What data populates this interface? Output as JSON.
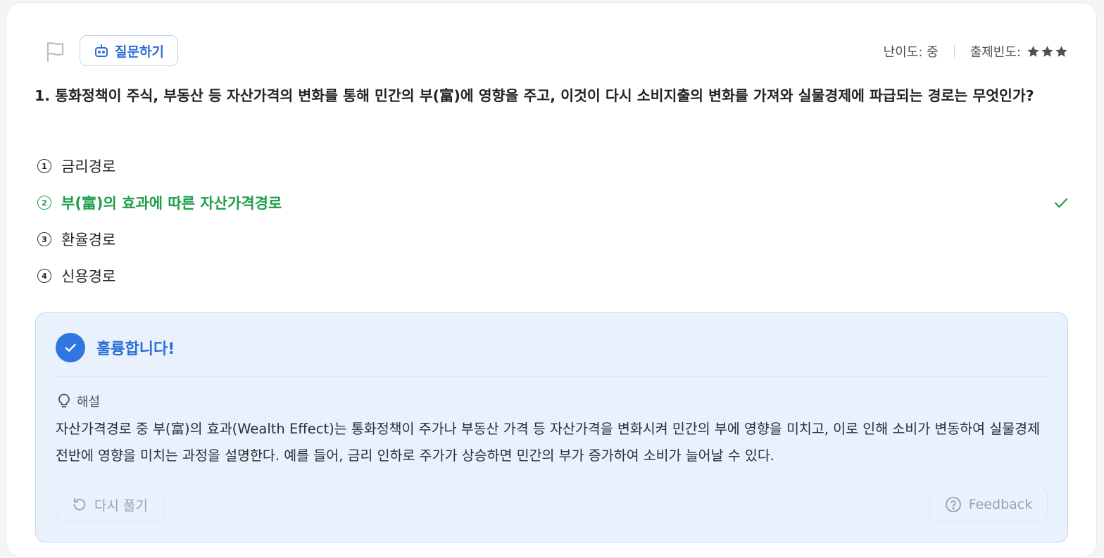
{
  "header": {
    "ask_label": "질문하기",
    "difficulty_label": "난이도: 중",
    "frequency_label": "출제빈도:",
    "frequency_stars": 3
  },
  "question": {
    "text": "1. 통화정책이 주식, 부동산 등 자산가격의 변화를 통해 민간의 부(富)에 영향을 주고, 이것이 다시 소비지출의 변화를 가져와 실물경제에 파급되는 경로는 무엇인가?"
  },
  "options": [
    {
      "num": "1",
      "label": "금리경로",
      "correct": false
    },
    {
      "num": "2",
      "label": "부(富)의 효과에 따른 자산가격경로",
      "correct": true
    },
    {
      "num": "3",
      "label": "환율경로",
      "correct": false
    },
    {
      "num": "4",
      "label": "신용경로",
      "correct": false
    }
  ],
  "explanation": {
    "result": "훌륭합니다!",
    "heading": "해설",
    "text": "자산가격경로 중 부(富)의 효과(Wealth Effect)는 통화정책이 주가나 부동산 가격 등 자산가격을 변화시켜 민간의 부에 영향을 미치고, 이로 인해 소비가 변동하여 실물경제 전반에 영향을 미치는 과정을 설명한다. 예를 들어, 금리 인하로 주가가 상승하면 민간의 부가 증가하여 소비가 늘어날 수 있다.",
    "retry_label": "다시 풀기",
    "feedback_label": "Feedback"
  },
  "colors": {
    "accent": "#2b6fd6",
    "correct": "#1e9e4a",
    "panel_bg": "#e9f1fc"
  }
}
